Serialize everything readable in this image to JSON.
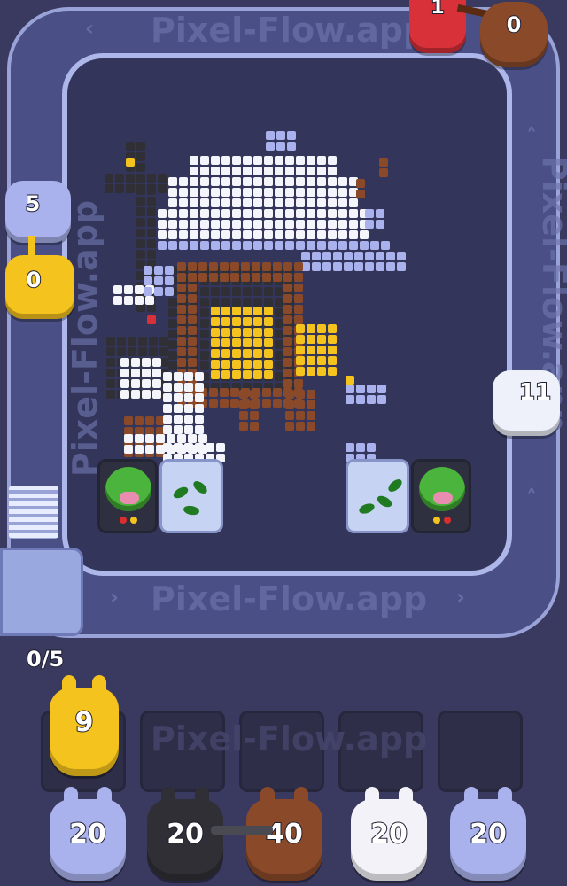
{
  "watermark": "Pixel-Flow.app",
  "progress_counter": "0/5",
  "conveyor_top_right": {
    "red_value": "1",
    "brown_value": "0"
  },
  "left_shooters": {
    "blue_value": "5",
    "yellow_value": "0"
  },
  "right_shooter": {
    "white_value": "11"
  },
  "queue_slot_value": "9",
  "bunnies": [
    {
      "color": "#a9b2ec",
      "value": "20"
    },
    {
      "color": "#2f2f35",
      "value": "20"
    },
    {
      "color": "#8a4a2a",
      "value": "40"
    },
    {
      "color": "#f2f2f8",
      "value": "20"
    },
    {
      "color": "#a9b2ec",
      "value": "20"
    }
  ],
  "colors": {
    "background": "#3a3a60",
    "track": "#4a4f85",
    "yellow": "#f5c31e"
  }
}
